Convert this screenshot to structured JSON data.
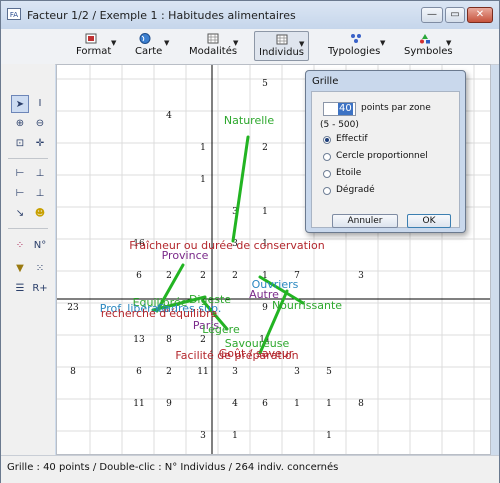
{
  "window": {
    "title": "Facteur 1/2 / Exemple 1 : Habitudes alimentaires",
    "icon": "app-icon",
    "buttons": {
      "minimize": "—",
      "maximize": "▭",
      "close": "✕"
    }
  },
  "toolbar": [
    {
      "name": "format",
      "label": "Format",
      "icon": "format-icon",
      "pressed": false
    },
    {
      "name": "carte",
      "label": "Carte",
      "icon": "globe-icon",
      "pressed": false
    },
    {
      "name": "modalites",
      "label": "Modalités",
      "icon": "grid-icon",
      "pressed": false
    },
    {
      "name": "individus",
      "label": "Individus",
      "icon": "grid-icon",
      "pressed": true
    },
    {
      "name": "typologies",
      "label": "Typologies",
      "icon": "typology-icon",
      "pressed": false
    },
    {
      "name": "symboles",
      "label": "Symboles",
      "icon": "symbols-icon",
      "pressed": false
    }
  ],
  "sidebar": {
    "tools": [
      "pointer-icon",
      "text-cursor-icon",
      "zoom-in-icon",
      "zoom-out-icon",
      "fit-view-icon",
      "crosshair-icon",
      "axis-1-icon",
      "axis-2-icon",
      "axis-3-icon",
      "axis-4-icon",
      "axis-graph-icon",
      "smiley-icon",
      "scatter-icon",
      "number-icon",
      "filter-icon",
      "cluster-icon",
      "list-icon",
      "r-plus-icon"
    ],
    "number_label": "N°",
    "rplus_label": "R+"
  },
  "plot": {
    "grid_counts": [
      "5",
      "4",
      "1",
      "2",
      "1",
      "3",
      "1",
      "16",
      "3",
      "1",
      "6",
      "2",
      "2",
      "2",
      "1",
      "7",
      "3",
      "23",
      "9",
      "13",
      "8",
      "2",
      "11",
      "8",
      "6",
      "2",
      "11",
      "3",
      "3",
      "5",
      "11",
      "9",
      "4",
      "6",
      "1",
      "1",
      "8",
      "3",
      "1",
      "1"
    ],
    "labels": [
      {
        "text": "Naturelle",
        "color": "#2ea82e"
      },
      {
        "text": "Fraîcheur ou durée de conservation",
        "color": "#b3262c"
      },
      {
        "text": "Province",
        "color": "#7a2a8a"
      },
      {
        "text": "Ouvriers",
        "color": "#2a88c0"
      },
      {
        "text": "Autre",
        "color": "#7a2a8a"
      },
      {
        "text": "Nourrissante",
        "color": "#2ea82e"
      },
      {
        "text": "Equilibrée",
        "color": "#2ea82e"
      },
      {
        "text": "Digeste",
        "color": "#2ea82e"
      },
      {
        "text": "Prof. libérale",
        "color": "#2a88c0"
      },
      {
        "text": "Cadres sup.",
        "color": "#2a88c0"
      },
      {
        "text": "recherche d'équilibre",
        "color": "#b3262c"
      },
      {
        "text": "Paris",
        "color": "#7a2a8a"
      },
      {
        "text": "Légère",
        "color": "#2ea82e"
      },
      {
        "text": "Savoureuse",
        "color": "#2ea82e"
      },
      {
        "text": "Facilité de préparation",
        "color": "#b3262c"
      },
      {
        "text": "Goût / saveur",
        "color": "#b3262c"
      }
    ]
  },
  "dialog": {
    "title": "Grille",
    "points_value": "40",
    "points_suffix": "points par zone",
    "range": "(5 - 500)",
    "options": [
      {
        "label": "Effectif",
        "selected": true
      },
      {
        "label": "Cercle proportionnel",
        "selected": false
      },
      {
        "label": "Etoile",
        "selected": false
      },
      {
        "label": "Dégradé",
        "selected": false
      }
    ],
    "cancel_label": "Annuler",
    "ok_label": "OK"
  },
  "status": {
    "text": "Grille : 40 points / Double-clic : N° Individus / 264 indiv. concernés"
  },
  "colors": {
    "green": "#2ea82e",
    "red": "#b3262c",
    "purple": "#7a2a8a",
    "blue": "#2a88c0"
  }
}
